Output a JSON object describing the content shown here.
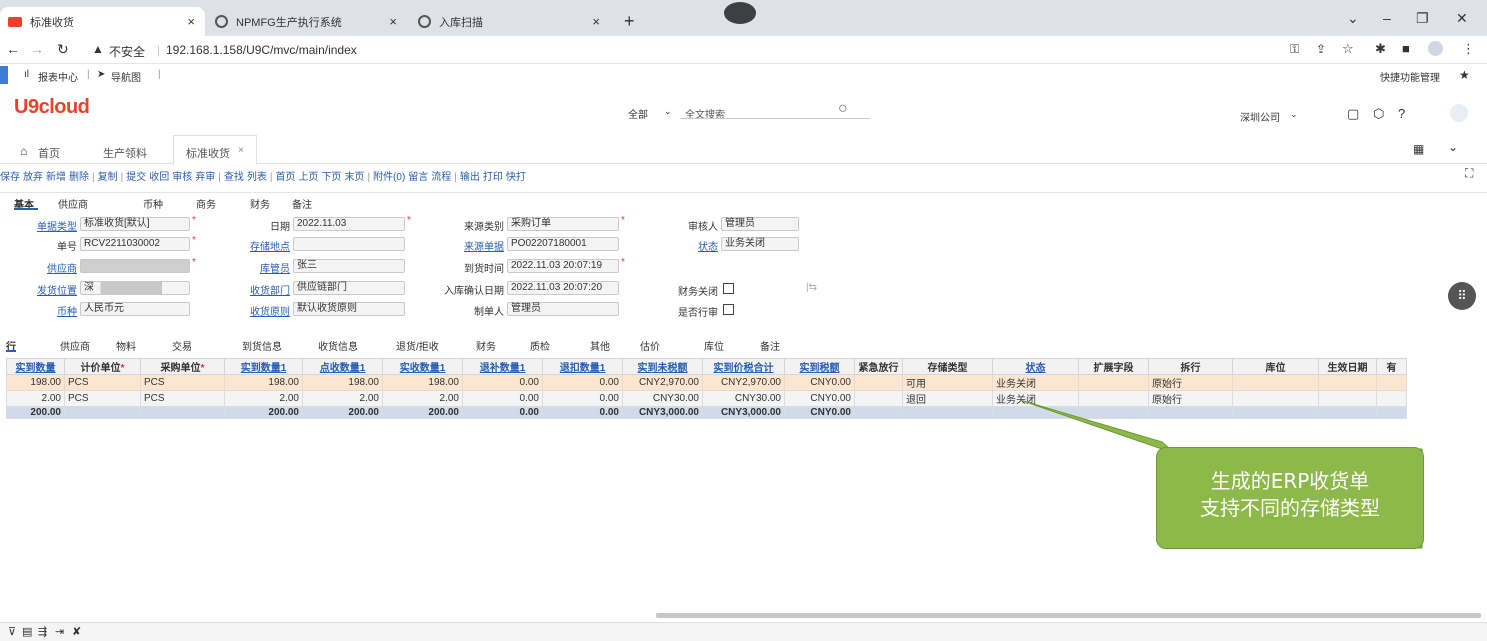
{
  "browser": {
    "tabs": [
      {
        "title": "标准收货",
        "active": true
      },
      {
        "title": "NPMFG生产执行系统",
        "active": false
      },
      {
        "title": "入库扫描",
        "active": false
      }
    ],
    "new_tab": "+",
    "insecure_label": "不安全",
    "url": "192.168.1.158/U9C/mvc/main/index",
    "bookmarks": [
      "报表中心",
      "导航图"
    ],
    "quick_manage": "快捷功能管理"
  },
  "app": {
    "logo": "U9cloud",
    "search_scope": "全部",
    "search_placeholder": "全文搜索",
    "company": "深圳公司"
  },
  "nav_tabs": [
    "首页",
    "生产领料",
    "标准收货"
  ],
  "toolbar": [
    "保存",
    "放弃",
    "新增",
    "删除",
    "|",
    "复制",
    "|",
    "提交",
    "收回",
    "审核",
    "弃审",
    "|",
    "查找",
    "列表",
    "|",
    "首页",
    "上页",
    "下页",
    "末页",
    "|",
    "附件(0)",
    "留言",
    "流程",
    "|",
    "输出",
    "打印",
    "快打"
  ],
  "form_tabs": [
    "基本",
    "供应商",
    "币种",
    "商务",
    "财务",
    "备注"
  ],
  "form": {
    "doc_type_label": "单据类型",
    "doc_type": "标准收货[默认]",
    "doc_no_label": "单号",
    "doc_no": "RCV2211030002",
    "supplier_label": "供应商",
    "ship_loc_label": "发货位置",
    "ship_loc": "深",
    "currency_label": "币种",
    "currency": "人民币元",
    "date_label": "日期",
    "date": "2022.11.03",
    "storage_label": "存储地点",
    "keeper_label": "库管员",
    "keeper": "张三",
    "dept_label": "收货部门",
    "dept": "供应链部门",
    "rule_label": "收货原则",
    "rule": "默认收货原则",
    "src_type_label": "来源类别",
    "src_type": "采购订单",
    "src_doc_label": "来源单据",
    "src_doc": "PO02207180001",
    "arrive_label": "到货时间",
    "arrive": "2022.11.03 20:07:19",
    "confirm_label": "入库确认日期",
    "confirm": "2022.11.03 20:07:20",
    "maker_label": "制单人",
    "maker": "管理员",
    "auditor_label": "审核人",
    "auditor": "管理员",
    "status_label": "状态",
    "status": "业务关闭",
    "fin_close_label": "财务关闭",
    "split_label": "是否行审"
  },
  "grid_tabs": [
    "行",
    "供应商",
    "物料",
    "交易",
    "到货信息",
    "收货信息",
    "退货/拒收",
    "财务",
    "质检",
    "其他",
    "估价",
    "库位",
    "备注"
  ],
  "grid": {
    "headers": [
      "实到数量",
      "计价单位",
      "采购单位",
      "实到数量1",
      "点收数量1",
      "实收数量1",
      "退补数量1",
      "退扣数量1",
      "实到未税额",
      "实到价税合计",
      "实到税额",
      "紧急放行",
      "存储类型",
      "状态",
      "扩展字段",
      "拆行",
      "库位",
      "生效日期",
      "有"
    ],
    "rows": [
      [
        "198.00",
        "PCS",
        "PCS",
        "198.00",
        "198.00",
        "198.00",
        "0.00",
        "0.00",
        "CNY2,970.00",
        "CNY2,970.00",
        "CNY0.00",
        "",
        "可用",
        "业务关闭",
        "",
        "原始行",
        "",
        "",
        ""
      ],
      [
        "2.00",
        "PCS",
        "PCS",
        "2.00",
        "2.00",
        "2.00",
        "0.00",
        "0.00",
        "CNY30.00",
        "CNY30.00",
        "CNY0.00",
        "",
        "退回",
        "业务关闭",
        "",
        "原始行",
        "",
        "",
        ""
      ]
    ],
    "total": [
      "200.00",
      "",
      "",
      "200.00",
      "200.00",
      "200.00",
      "0.00",
      "0.00",
      "CNY3,000.00",
      "CNY3,000.00",
      "CNY0.00",
      "",
      "",
      "",
      "",
      "",
      "",
      "",
      ""
    ]
  },
  "callout": {
    "line1": "生成的ERP收货单",
    "line2": "支持不同的存储类型",
    "fill": "#8db84a"
  }
}
